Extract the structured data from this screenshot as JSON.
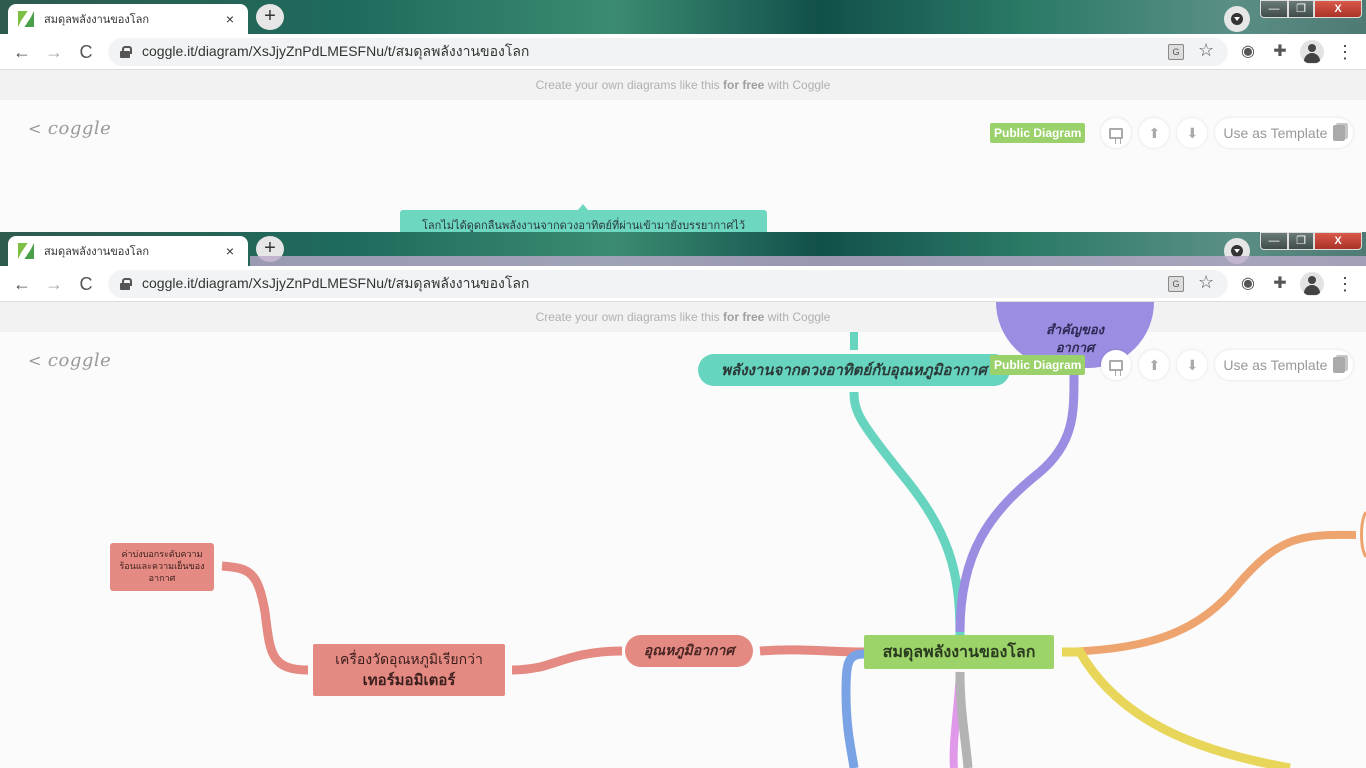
{
  "browser": {
    "tab_title": "สมดุลพลังงานของโลก",
    "tab_close": "×",
    "new_tab": "+",
    "url": "coggle.it/diagram/XsJjyZnPdLMESFNu/t/สมดุลพลังงานของโลก",
    "nav": {
      "back": "←",
      "forward": "→",
      "reload": "C"
    },
    "window_controls": {
      "minimize": "—",
      "maximize": "❐",
      "close": "X"
    },
    "translate_label": "G",
    "star": "☆",
    "extension_1": "◉",
    "extension_2": "✚",
    "menu": "⋮"
  },
  "banner": {
    "prefix": "Create your own diagrams like this ",
    "bold": "for free",
    "suffix": " with Coggle"
  },
  "coggle": {
    "logo_chevron": "<",
    "logo_text": "coggle",
    "public_badge": "Public Diagram",
    "use_template_label": "Use as Template",
    "upload_icon": "⬆",
    "download_icon": "⬇"
  },
  "diagram": {
    "tooltip_node": "โลกไม่ได้ดูดกลืนพลังงานจากดวงอาทิตย์ที่ผ่านเข้ามายังบรรยากาศไว้",
    "teal_node": "พลังงานจากดวงอาทิตย์กับอุณหภูมิอากาศ",
    "purple_node_line1": "สำคัญของ",
    "purple_node_line2": "อากาศ",
    "root_node": "สมดุลพลังงานของโลก",
    "temperature_node": "อุณหภูมิอากาศ",
    "thermometer_line1": "เครื่องวัดอุณหภูมิเรียกว่า",
    "thermometer_line2": "เทอร์มอมิเตอร์",
    "description_node": "ค่าบ่งบอกระดับความร้อนและความเย็นของอากาศ",
    "branch_colors": {
      "teal": "#67d4bf",
      "purple": "#9b8ee2",
      "red": "#e58a83",
      "green": "#9dd46a",
      "orange": "#eea46e",
      "yellow": "#e8d65a",
      "blue": "#7aa3e5",
      "pink": "#e098e8",
      "gray": "#b3b3b3"
    }
  }
}
